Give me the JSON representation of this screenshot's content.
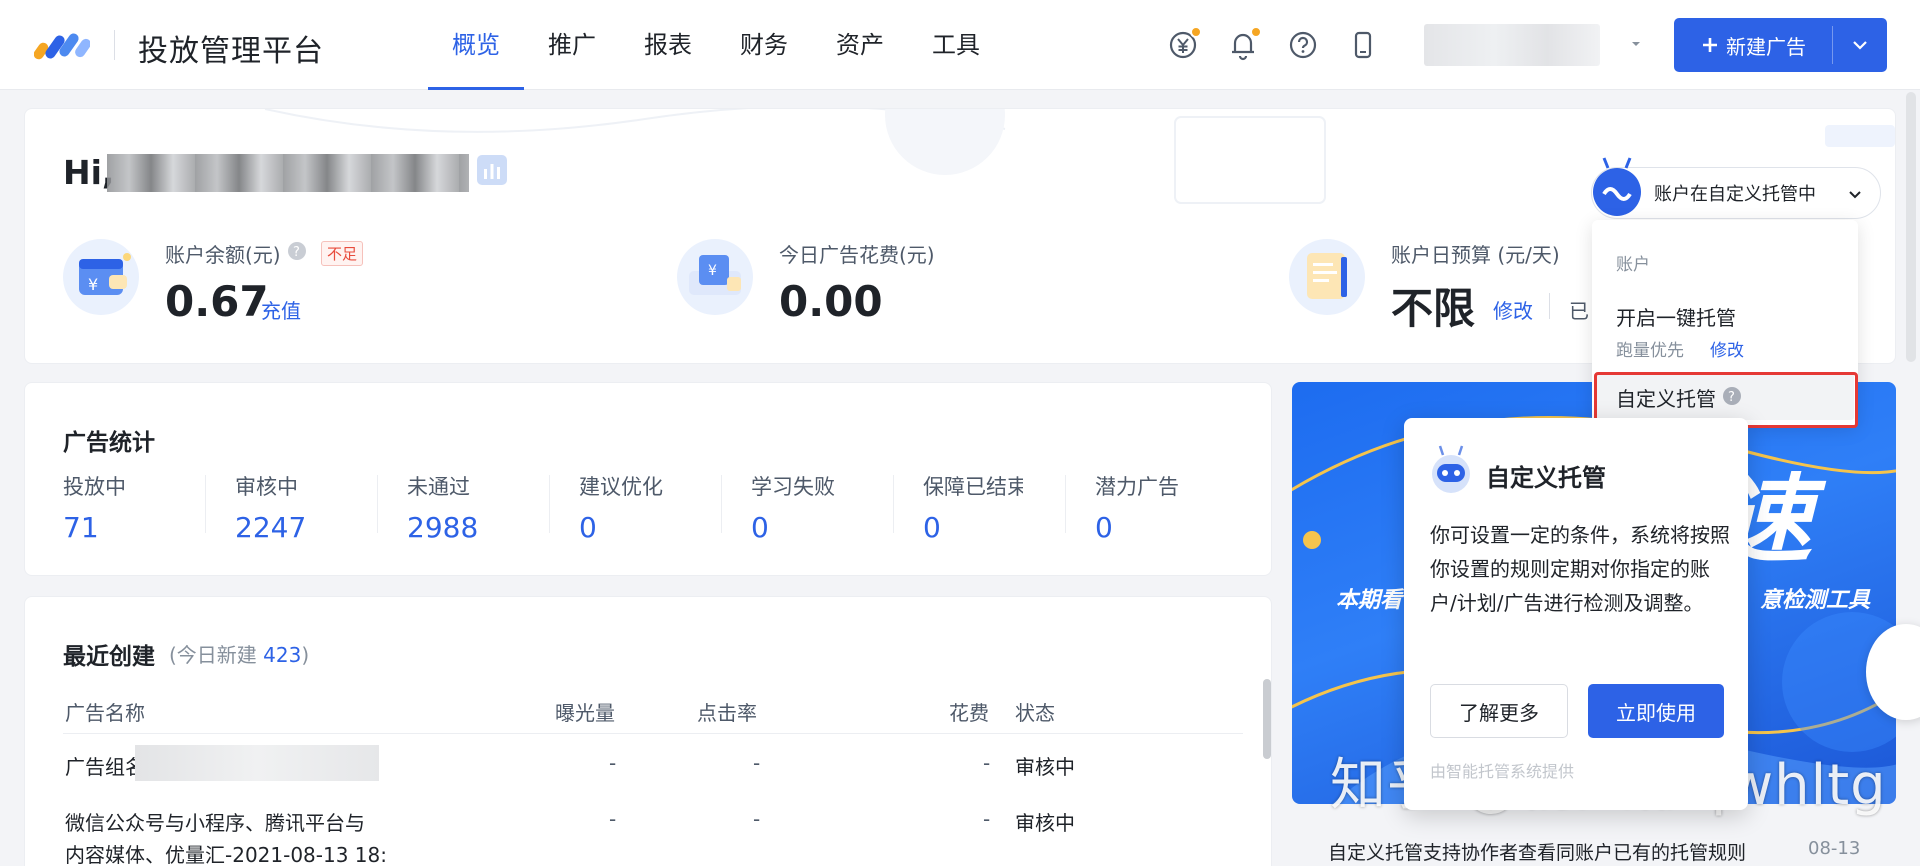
{
  "app": {
    "title": "投放管理平台"
  },
  "nav": {
    "items": [
      {
        "label": "概览",
        "active": true
      },
      {
        "label": "推广"
      },
      {
        "label": "报表"
      },
      {
        "label": "财务"
      },
      {
        "label": "资产"
      },
      {
        "label": "工具"
      }
    ]
  },
  "toolbar": {
    "new_ad_label": "新建广告"
  },
  "colors": {
    "accent": "#2d62e6",
    "warn": "#e84c3d",
    "badge_dot": "#f5a623"
  },
  "header": {
    "greeting": "Hi,",
    "managed_status": "账户在自定义托管中"
  },
  "stats_top": {
    "balance": {
      "label": "账户余额(元)",
      "badge": "不足",
      "value": "0.67",
      "action": "充值"
    },
    "today_spend": {
      "label": "今日广告花费(元)",
      "value": "0.00"
    },
    "daily_budget": {
      "label": "账户日预算 (元/天)",
      "value": "不限",
      "action": "修改",
      "trailing": "已"
    }
  },
  "dropdown": {
    "group_label": "账户",
    "item1": "开启一键托管",
    "item1_sub": "跑量优先",
    "item1_sub_action": "修改",
    "item2": "自定义托管"
  },
  "ad_stats": {
    "title": "广告统计",
    "cols": [
      {
        "label": "投放中",
        "value": "71"
      },
      {
        "label": "审核中",
        "value": "2247"
      },
      {
        "label": "未通过",
        "value": "2988"
      },
      {
        "label": "建议优化",
        "value": "0"
      },
      {
        "label": "学习失败",
        "value": "0"
      },
      {
        "label": "保障已结束",
        "value": "0"
      },
      {
        "label": "潜力广告",
        "value": "0"
      }
    ]
  },
  "recent": {
    "title": "最近创建",
    "sub_prefix": "(今日新建 ",
    "sub_count": "423",
    "sub_suffix": ")",
    "headers": {
      "name": "广告名称",
      "impressions": "曝光量",
      "ctr": "点击率",
      "spend": "花费",
      "status": "状态"
    },
    "rows": [
      {
        "name": "广告组名",
        "impressions": "-",
        "ctr": "-",
        "spend": "-",
        "status": "审核中"
      },
      {
        "name_line1": "微信公众号与小程序、腾讯平台与",
        "name_line2": "内容媒体、优量汇-2021-08-13 18:",
        "impressions": "-",
        "ctr": "-",
        "spend": "-",
        "status": "审核中"
      }
    ]
  },
  "banner": {
    "left_text": "本期看",
    "right_text": "意检测工具",
    "big_char": "速",
    "watermark": "知乎 @杨文彬qwhltg",
    "news_title": "自定义托管支持协作者查看同账户已有的托管规则",
    "news_date": "08-13"
  },
  "popover": {
    "title": "自定义托管",
    "body": "你可设置一定的条件，系统将按照你设置的规则定期对你指定的账户/计划/广告进行检测及调整。",
    "learn_more": "了解更多",
    "use_now": "立即使用",
    "footer": "由智能托管系统提供"
  }
}
